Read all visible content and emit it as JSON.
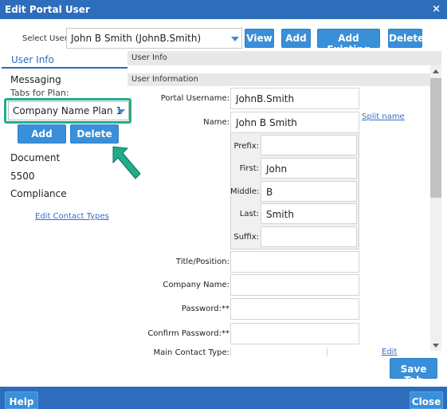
{
  "window": {
    "title": "Edit Portal User",
    "close_glyph": "×"
  },
  "toolbar": {
    "select_user_label": "Select User:",
    "select_user_value": "John B Smith (JohnB.Smith)",
    "view": "View",
    "add": "Add",
    "add_existing": "Add Existing",
    "delete": "Delete"
  },
  "left": {
    "tab_user_info": "User Info",
    "messaging": "Messaging",
    "tabs_for_plan": "Tabs for Plan:",
    "plan_value": "Company Name Plan 1",
    "add": "Add",
    "delete": "Delete",
    "document": "Document",
    "f5500": "5500",
    "compliance": "Compliance",
    "edit_contact_types": "Edit Contact Types"
  },
  "main": {
    "band_user_info": "User Info",
    "band_user_information": "User Information",
    "portal_username_label": "Portal Username:",
    "portal_username_value": "JohnB.Smith",
    "name_label": "Name:",
    "name_value": "John B Smith",
    "split_name": "Split name",
    "prefix_label": "Prefix:",
    "prefix_value": "",
    "first_label": "First:",
    "first_value": "John",
    "middle_label": "Middle:",
    "middle_value": "B",
    "last_label": "Last:",
    "last_value": "Smith",
    "suffix_label": "Suffix:",
    "suffix_value": "",
    "title_label": "Title/Position:",
    "company_label": "Company Name:",
    "password_label": "Password:**",
    "confirm_password_label": "Confirm Password:**",
    "main_contact_label": "Main Contact Type:",
    "edit": "Edit",
    "save_tab": "Save Tab"
  },
  "footer": {
    "help": "Help",
    "close": "Close"
  },
  "colors": {
    "brand": "#2d6dbb",
    "button": "#3a8fd9",
    "highlight": "#1fae8a",
    "arrow": "#1fae8a"
  },
  "icons": [
    "close-icon",
    "chevron-down-icon",
    "scroll-up-icon",
    "scroll-down-icon",
    "pointer-arrow-icon"
  ]
}
